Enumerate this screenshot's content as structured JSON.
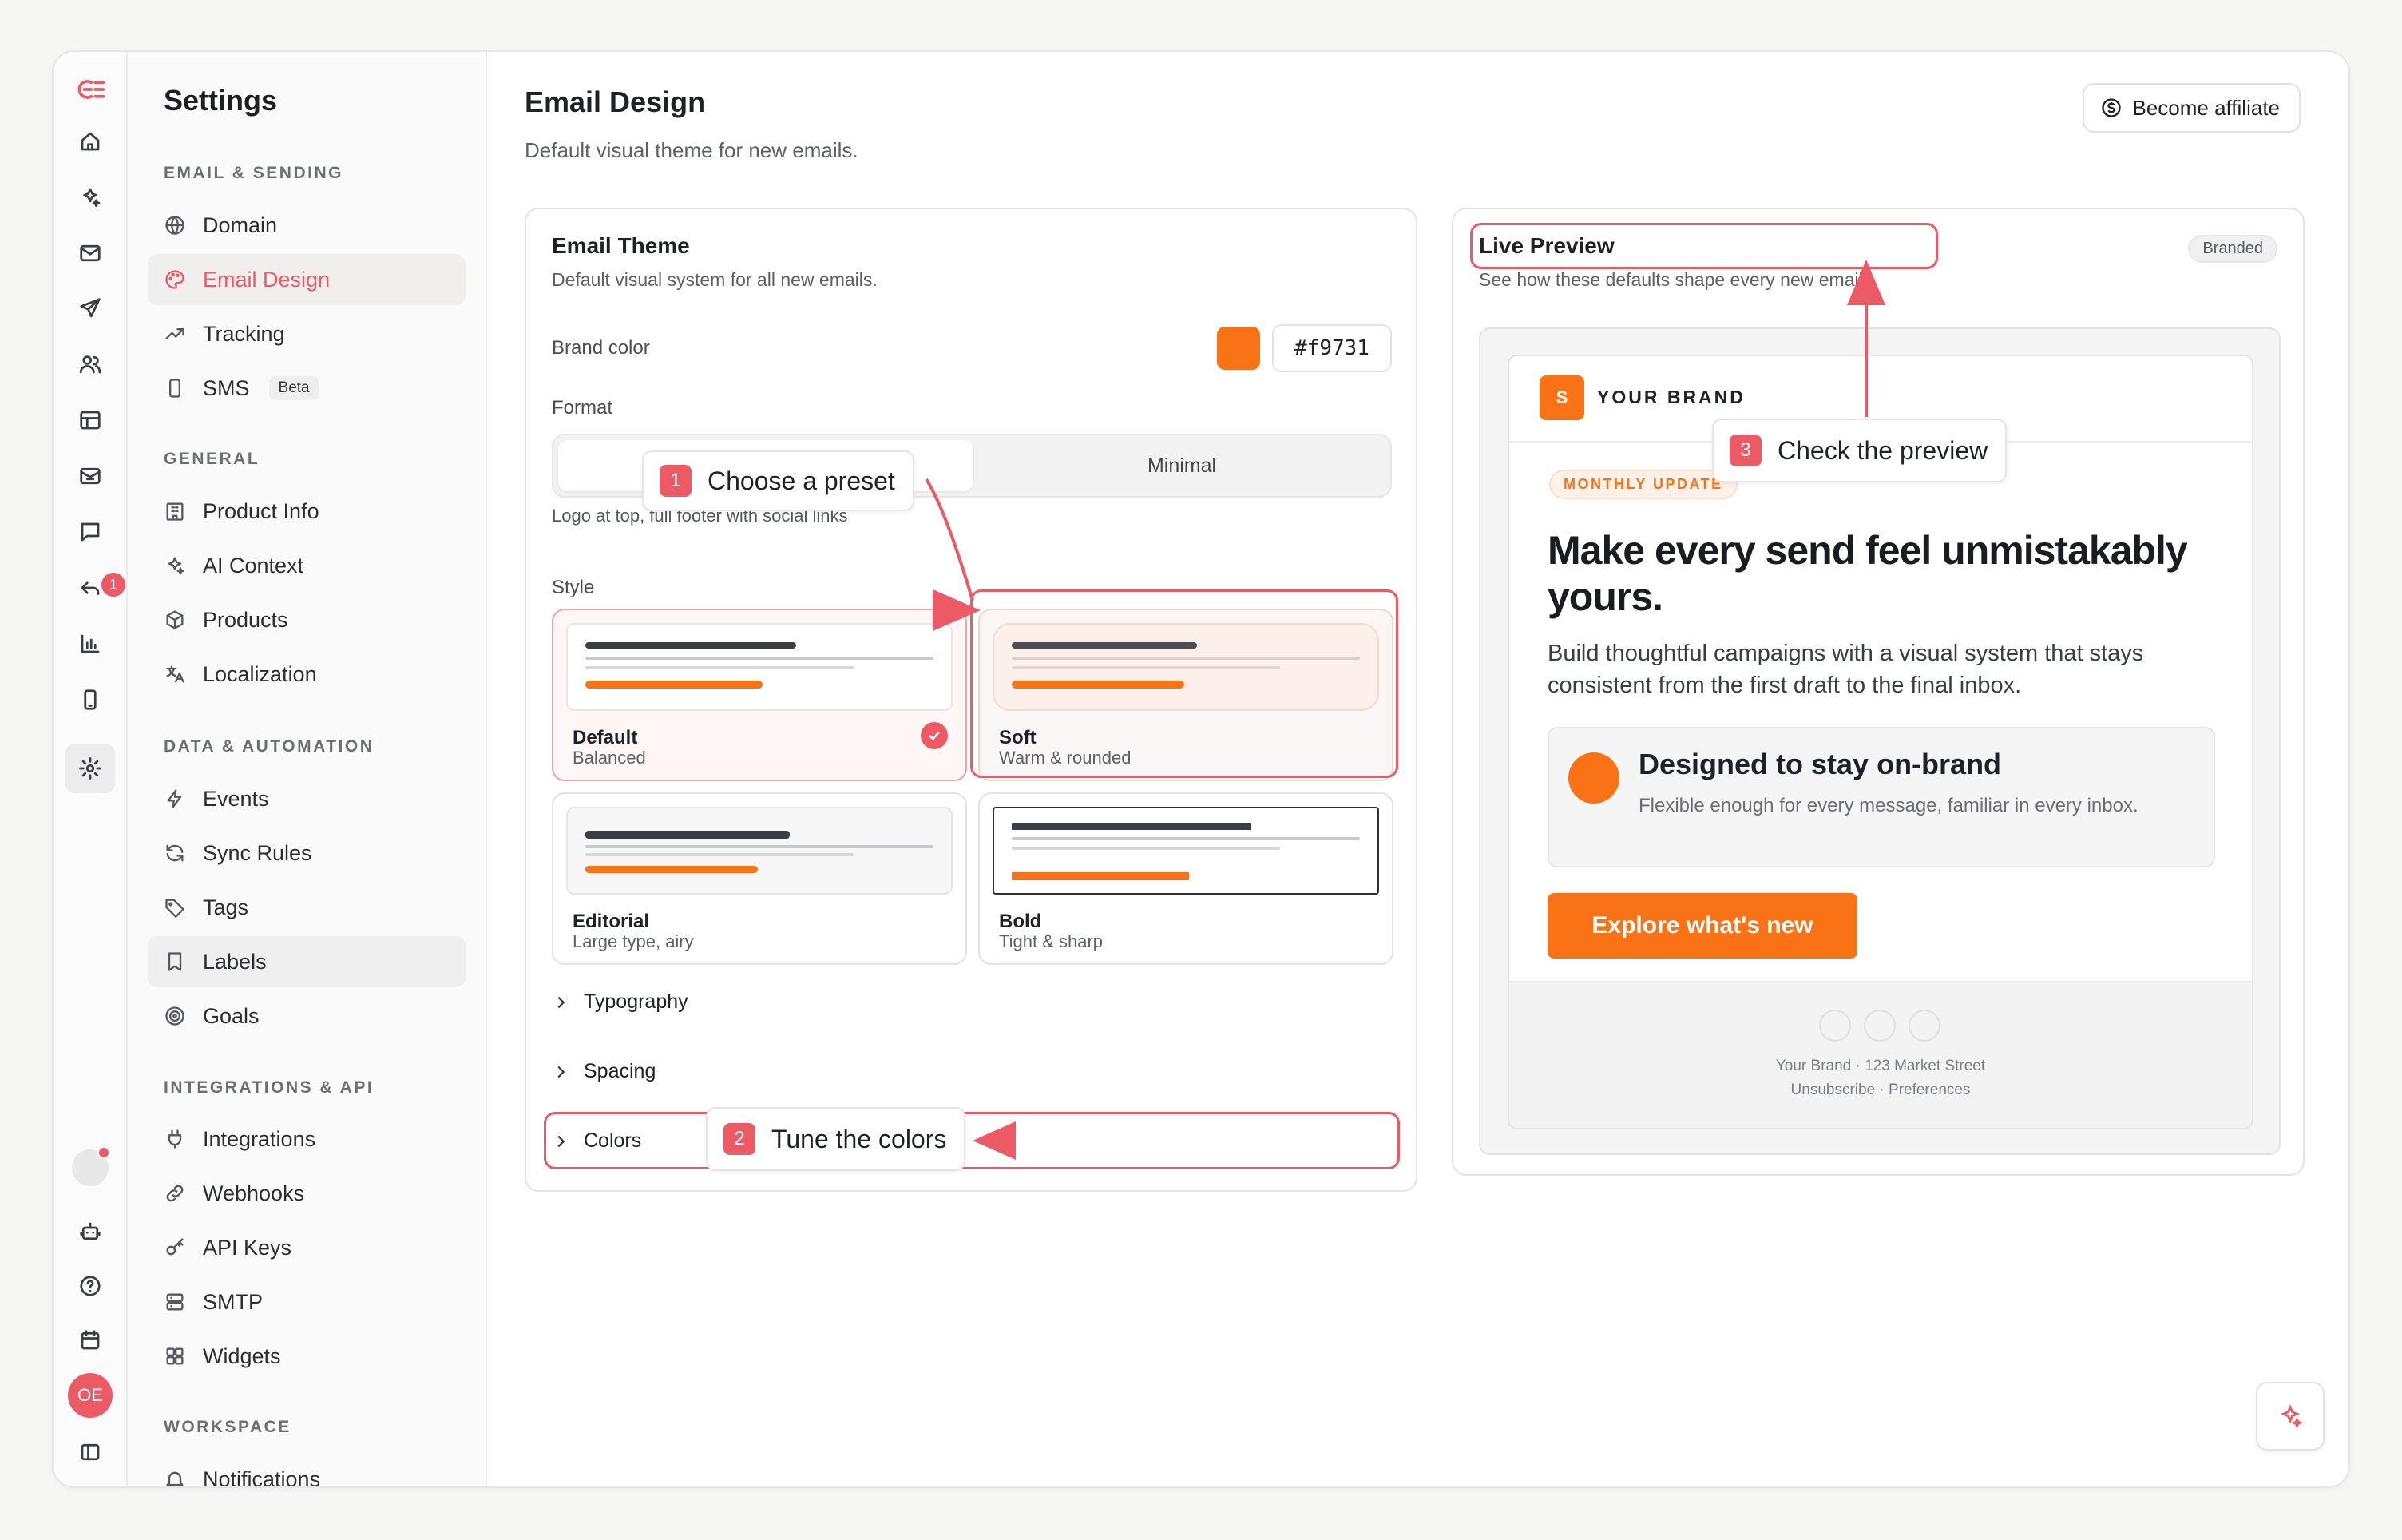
{
  "sidebar": {
    "title": "Settings",
    "badge_count": "1",
    "avatar_initials": "OE",
    "sections": {
      "email_sending": "EMAIL & SENDING",
      "general": "GENERAL",
      "data_automation": "DATA & AUTOMATION",
      "integrations": "INTEGRATIONS & API",
      "workspace": "WORKSPACE"
    },
    "items": {
      "domain": "Domain",
      "email_design": "Email Design",
      "tracking": "Tracking",
      "sms": "SMS",
      "sms_badge": "Beta",
      "product_info": "Product Info",
      "ai_context": "AI Context",
      "products": "Products",
      "localization": "Localization",
      "events": "Events",
      "sync_rules": "Sync Rules",
      "tags": "Tags",
      "labels": "Labels",
      "goals": "Goals",
      "integrations": "Integrations",
      "webhooks": "Webhooks",
      "api_keys": "API Keys",
      "smtp": "SMTP",
      "widgets": "Widgets",
      "notifications": "Notifications"
    }
  },
  "header": {
    "title": "Email Design",
    "subtitle": "Default visual theme for new emails.",
    "affiliate_button": "Become affiliate"
  },
  "theme": {
    "title": "Email Theme",
    "subtitle": "Default visual system for all new emails.",
    "brand_color_label": "Brand color",
    "brand_color_value": "#f9731",
    "brand_color_hex": "#f97316",
    "format_label": "Format",
    "format_option_2": "Minimal",
    "format_description": "Logo at top, full footer with social links",
    "style_label": "Style",
    "styles": [
      {
        "name": "Default",
        "desc": "Balanced",
        "selected": true
      },
      {
        "name": "Soft",
        "desc": "Warm & rounded",
        "selected": false
      },
      {
        "name": "Editorial",
        "desc": "Large type, airy",
        "selected": false
      },
      {
        "name": "Bold",
        "desc": "Tight & sharp",
        "selected": false
      }
    ],
    "sections": {
      "typography": "Typography",
      "spacing": "Spacing",
      "colors": "Colors"
    }
  },
  "preview": {
    "title": "Live Preview",
    "subtitle": "See how these defaults shape every new email.",
    "badge": "Branded",
    "email": {
      "logo_letter": "S",
      "brand": "YOUR BRAND",
      "eyebrow": "MONTHLY UPDATE",
      "headline": "Make every send feel unmistakably yours.",
      "body": "Build thoughtful campaigns with a visual system that stays consistent from the first draft to the final inbox.",
      "feature_title": "Designed to stay on-brand",
      "feature_body": "Flexible enough for every message, familiar in every inbox.",
      "cta": "Explore what's new",
      "footer_address": "Your Brand · 123 Market Street",
      "footer_links": "Unsubscribe · Preferences"
    }
  },
  "annotations": [
    {
      "num": "1",
      "text": "Choose a preset"
    },
    {
      "num": "2",
      "text": "Tune the colors"
    },
    {
      "num": "3",
      "text": "Check the preview"
    }
  ],
  "colors": {
    "accent": "#ec5a65",
    "brand": "#f97316"
  }
}
